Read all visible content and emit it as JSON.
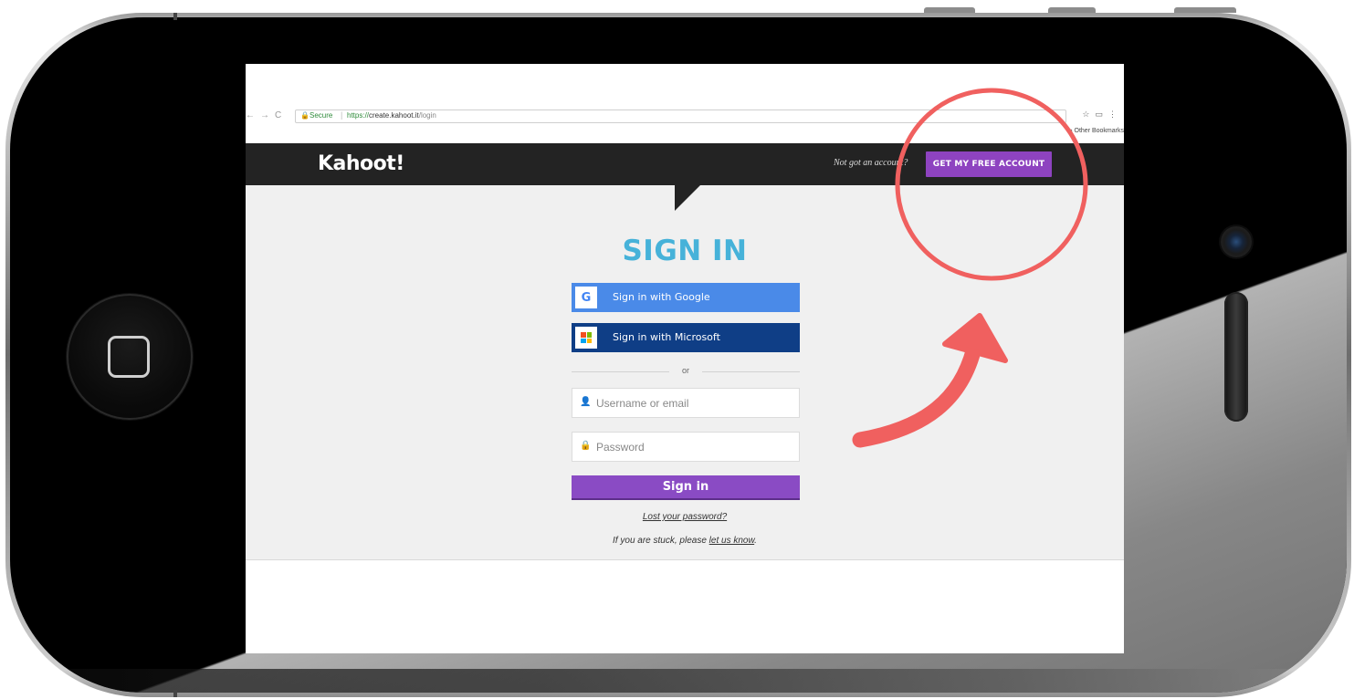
{
  "browser": {
    "secure_label": "Secure",
    "url_protocol": "https://",
    "url_host": "create.kahoot.it",
    "url_path": "/login",
    "bookmarks_label": "» Other Bookmarks"
  },
  "header": {
    "logo": "Kahoot!",
    "not_got_account": "Not got an account?",
    "free_account_label": "GET MY FREE ACCOUNT"
  },
  "signin": {
    "title": "SIGN IN",
    "google_label": "Sign in with Google",
    "microsoft_label": "Sign in with Microsoft",
    "or_label": "or",
    "username_placeholder": "Username or email",
    "password_placeholder": "Password",
    "submit_label": "Sign in",
    "lost_password": "Lost your password?",
    "stuck_prefix": "If you are stuck, please ",
    "stuck_link": "let us know",
    "stuck_suffix": "."
  },
  "colors": {
    "accent_purple": "#8a4bc4",
    "title_blue": "#46b2d9",
    "google_blue": "#4a8ae8",
    "microsoft_navy": "#0f3e86",
    "annotation_red": "#f0605f"
  },
  "icons": {
    "back": "arrow-left-icon",
    "forward": "arrow-right-icon",
    "reload": "reload-icon",
    "lock": "lock-icon",
    "star": "star-icon",
    "cast": "cast-icon",
    "menu": "kebab-menu-icon",
    "folder": "folder-icon",
    "google": "google-icon",
    "microsoft": "microsoft-icon",
    "user": "user-icon",
    "padlock": "padlock-icon"
  }
}
